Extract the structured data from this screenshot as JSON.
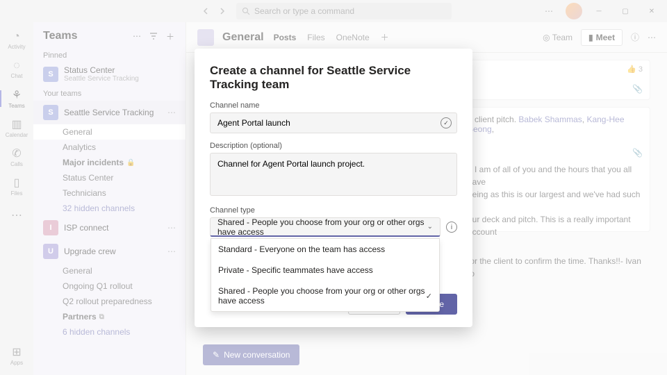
{
  "titlebar": {
    "search_placeholder": "Search or type a command"
  },
  "rail": {
    "items": [
      {
        "label": "Activity"
      },
      {
        "label": "Chat"
      },
      {
        "label": "Teams"
      },
      {
        "label": "Calendar"
      },
      {
        "label": "Calls"
      },
      {
        "label": "Files"
      }
    ],
    "apps_label": "Apps"
  },
  "sidebar": {
    "title": "Teams",
    "pinned_label": "Pinned",
    "pinned": {
      "title": "Status Center",
      "subtitle": "Seattle Service Tracking"
    },
    "your_teams_label": "Your teams",
    "teams": [
      {
        "name": "Seattle Service Tracking",
        "tile": "S",
        "channels": [
          {
            "name": "General",
            "active": true
          },
          {
            "name": "Analytics"
          },
          {
            "name": "Major incidents",
            "bold": true,
            "lock": true
          },
          {
            "name": "Status Center"
          },
          {
            "name": "Technicians"
          },
          {
            "name": "32 hidden channels",
            "link": true
          }
        ]
      },
      {
        "name": "ISP connect",
        "tile": "I"
      },
      {
        "name": "Upgrade crew",
        "tile": "U",
        "channels": [
          {
            "name": "General"
          },
          {
            "name": "Ongoing Q1 rollout"
          },
          {
            "name": "Q2 rollout preparedness"
          },
          {
            "name": "Partners",
            "bold": true,
            "share": true
          },
          {
            "name": "6 hidden channels",
            "link": true
          }
        ]
      }
    ]
  },
  "header": {
    "title": "General",
    "tabs": [
      "Posts",
      "Files",
      "OneNote"
    ],
    "team_btn": "Team",
    "meet_btn": "Meet"
  },
  "messages": {
    "reaction_count": "3",
    "msg1_tail": "e client pitch.",
    "mention1": "Babek Shammas",
    "mention2": "Kang-Hee Seong",
    "msg2_a": "e I am of all of you and the hours that you all have",
    "msg2_b": "eeing as this is our largest and we've had such a",
    "msg2_c": "our deck and pitch. This is a really important account",
    "msg2_d": "for the client to confirm the time. Thanks!!- Ivan to",
    "new_conv": "New conversation"
  },
  "modal": {
    "title": "Create a channel for Seattle Service Tracking team",
    "name_label": "Channel name",
    "name_value": "Agent Portal launch",
    "desc_label": "Description (optional)",
    "desc_value": "Channel for Agent Portal launch project.",
    "type_label": "Channel type",
    "type_selected": "Shared - People you choose from your org or other orgs have access",
    "options": [
      "Standard - Everyone on the team has access",
      "Private - Specific teammates have access",
      "Shared - People you choose from your org or other orgs have access"
    ],
    "cancel": "Cancel",
    "create": "Create"
  }
}
